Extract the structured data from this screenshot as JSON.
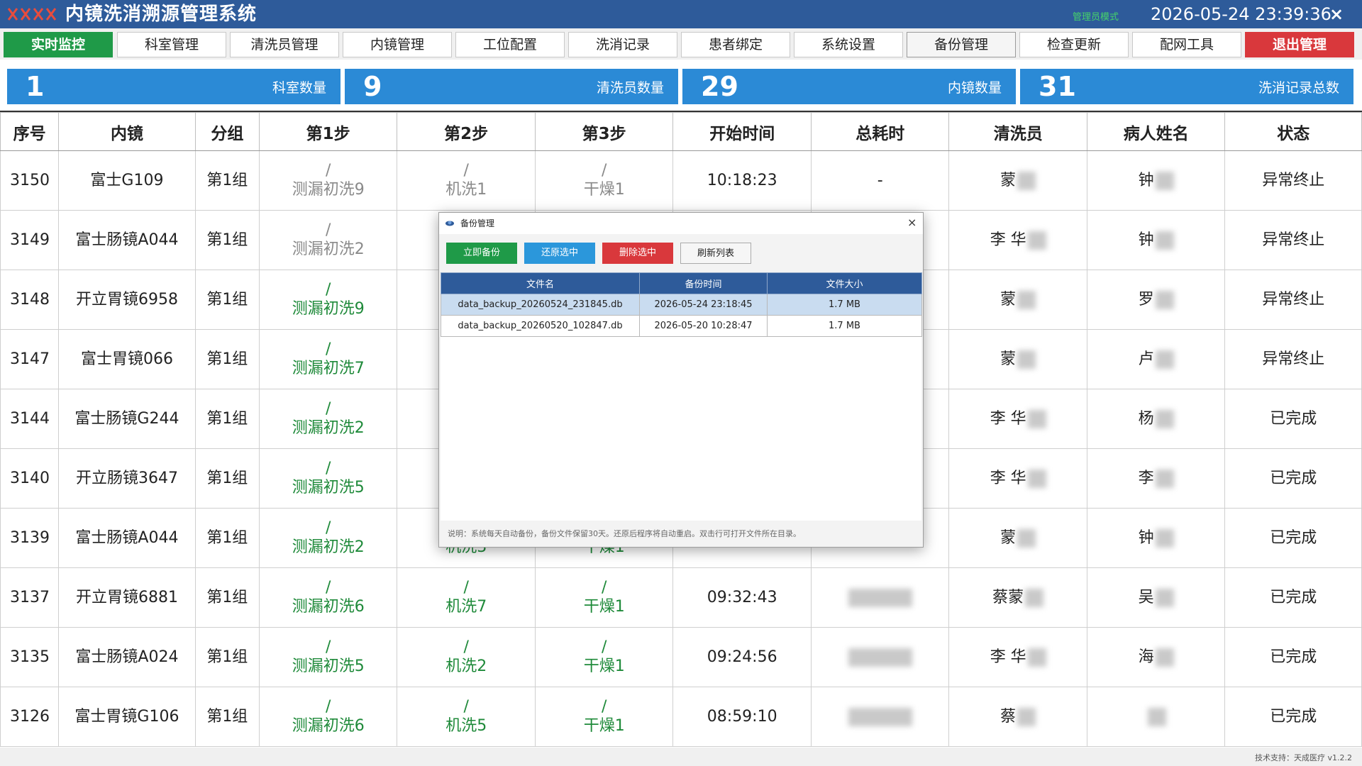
{
  "app": {
    "title": "内镜洗消溯源管理系统",
    "mode": "管理员模式",
    "datetime": "2026-05-24 23:39:36",
    "close": "×"
  },
  "nav": {
    "items": [
      {
        "label": "实时监控",
        "state": "active"
      },
      {
        "label": "科室管理",
        "state": "normal"
      },
      {
        "label": "清洗员管理",
        "state": "normal"
      },
      {
        "label": "内镜管理",
        "state": "normal"
      },
      {
        "label": "工位配置",
        "state": "normal"
      },
      {
        "label": "洗消记录",
        "state": "normal"
      },
      {
        "label": "患者绑定",
        "state": "normal"
      },
      {
        "label": "系统设置",
        "state": "normal"
      },
      {
        "label": "备份管理",
        "state": "hover"
      },
      {
        "label": "检查更新",
        "state": "normal"
      },
      {
        "label": "配网工具",
        "state": "normal"
      },
      {
        "label": "退出管理",
        "state": "exit"
      }
    ]
  },
  "stats": [
    {
      "value": "1",
      "label": "科室数量"
    },
    {
      "value": "9",
      "label": "清洗员数量"
    },
    {
      "value": "29",
      "label": "内镜数量"
    },
    {
      "value": "31",
      "label": "洗消记录总数"
    }
  ],
  "table": {
    "headers": [
      "序号",
      "内镜",
      "分组",
      "第1步",
      "第2步",
      "第3步",
      "开始时间",
      "总耗时",
      "清洗员",
      "病人姓名",
      "状态"
    ],
    "rows": [
      {
        "id": "3150",
        "scope": "富士G109",
        "group": "第1组",
        "s1": "测漏初洗9",
        "s1c": "grey",
        "s2": "机洗1",
        "s2c": "grey",
        "s3": "干燥1",
        "s3c": "grey",
        "start": "10:18:23",
        "total": "-",
        "washer": "蒙",
        "patient": "钟",
        "status": "异常终止"
      },
      {
        "id": "3149",
        "scope": "富士肠镜A044",
        "group": "第1组",
        "s1": "测漏初洗2",
        "s1c": "grey",
        "s2": "",
        "s2c": "grey",
        "s3": "",
        "s3c": "grey",
        "start": "",
        "total": "",
        "washer": "李 华",
        "patient": "钟",
        "status": "异常终止"
      },
      {
        "id": "3148",
        "scope": "开立胃镜6958",
        "group": "第1组",
        "s1": "测漏初洗9",
        "s1c": "green",
        "s2": "",
        "s2c": "green",
        "s3": "",
        "s3c": "green",
        "start": "",
        "total": "",
        "washer": "蒙",
        "patient": "罗",
        "status": "异常终止"
      },
      {
        "id": "3147",
        "scope": "富士胃镜066",
        "group": "第1组",
        "s1": "测漏初洗7",
        "s1c": "green",
        "s2": "",
        "s2c": "green",
        "s3": "",
        "s3c": "green",
        "start": "",
        "total": "",
        "washer": "蒙",
        "patient": "卢",
        "status": "异常终止"
      },
      {
        "id": "3144",
        "scope": "富士肠镜G244",
        "group": "第1组",
        "s1": "测漏初洗2",
        "s1c": "green",
        "s2": "",
        "s2c": "green",
        "s3": "",
        "s3c": "green",
        "start": "",
        "total": "",
        "washer": "李 华",
        "patient": "杨",
        "status": "已完成"
      },
      {
        "id": "3140",
        "scope": "开立肠镜3647",
        "group": "第1组",
        "s1": "测漏初洗5",
        "s1c": "green",
        "s2": "",
        "s2c": "green",
        "s3": "",
        "s3c": "green",
        "start": "",
        "total": "",
        "washer": "李 华",
        "patient": "李",
        "status": "已完成"
      },
      {
        "id": "3139",
        "scope": "富士肠镜A044",
        "group": "第1组",
        "s1": "测漏初洗2",
        "s1c": "green",
        "s2": "机洗3",
        "s2c": "green",
        "s3": "干燥1",
        "s3c": "green",
        "start": "",
        "total": "",
        "washer": "蒙",
        "patient": "钟",
        "status": "已完成"
      },
      {
        "id": "3137",
        "scope": "开立胃镜6881",
        "group": "第1组",
        "s1": "测漏初洗6",
        "s1c": "green",
        "s2": "机洗7",
        "s2c": "green",
        "s3": "干燥1",
        "s3c": "green",
        "start": "09:32:43",
        "total": "",
        "washer": "蔡蒙",
        "patient": "吴",
        "status": "已完成"
      },
      {
        "id": "3135",
        "scope": "富士肠镜A024",
        "group": "第1组",
        "s1": "测漏初洗5",
        "s1c": "green",
        "s2": "机洗2",
        "s2c": "green",
        "s3": "干燥1",
        "s3c": "green",
        "start": "09:24:56",
        "total": "",
        "washer": "李 华",
        "patient": "海",
        "status": "已完成"
      },
      {
        "id": "3126",
        "scope": "富士胃镜G106",
        "group": "第1组",
        "s1": "测漏初洗6",
        "s1c": "green",
        "s2": "机洗5",
        "s2c": "green",
        "s3": "干燥1",
        "s3c": "green",
        "start": "08:59:10",
        "total": "",
        "washer": "蔡",
        "patient": "",
        "status": "已完成"
      }
    ]
  },
  "dialog": {
    "title": "备份管理",
    "close": "×",
    "buttons": {
      "backup": "立即备份",
      "restore": "还原选中",
      "delete": "删除选中",
      "refresh": "刷新列表"
    },
    "headers": [
      "文件名",
      "备份时间",
      "文件大小"
    ],
    "rows": [
      {
        "file": "data_backup_20260524_231845.db",
        "time": "2026-05-24 23:18:45",
        "size": "1.7 MB",
        "selected": true
      },
      {
        "file": "data_backup_20260520_102847.db",
        "time": "2026-05-20 10:28:47",
        "size": "1.7 MB",
        "selected": false
      }
    ],
    "note": "说明：系统每天自动备份，备份文件保留30天。还原后程序将自动重启。双击行可打开文件所在目录。"
  },
  "footer": {
    "text": "技术支持：天成医疗 v1.2.2"
  },
  "colors": {
    "title_bar": "#2e5b9a",
    "active_nav": "#1f9a48",
    "exit_nav": "#d9383c",
    "stat_tile": "#2b8ad6",
    "step_done": "#1f8a3a",
    "step_pending": "#8a8a8a",
    "mode_label": "#46d36a"
  }
}
